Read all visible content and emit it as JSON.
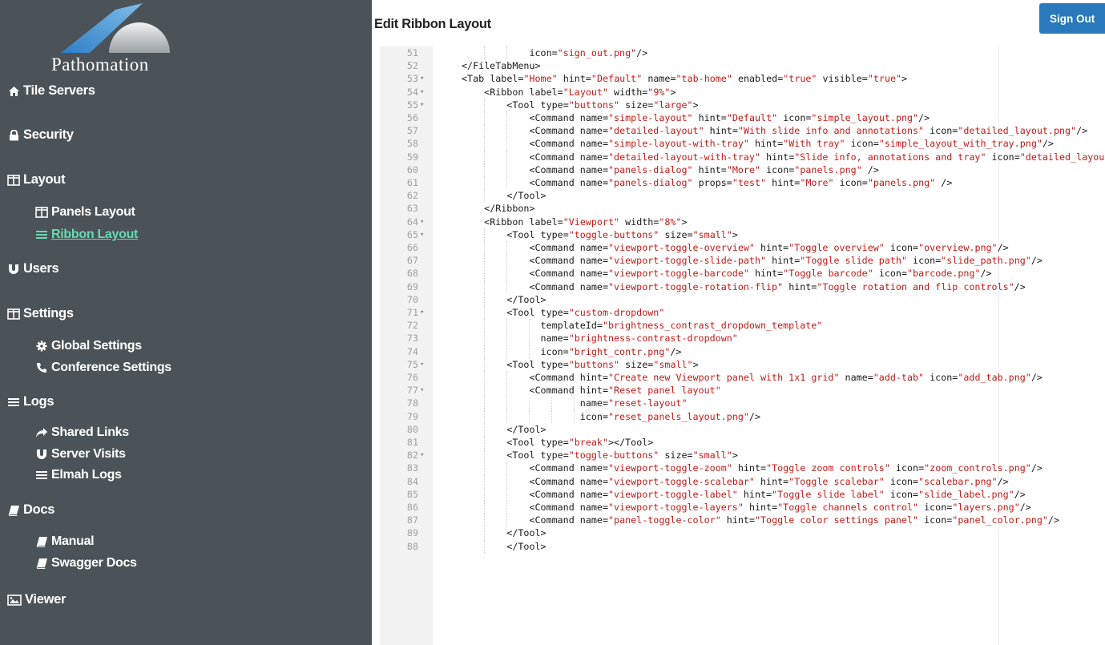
{
  "brand": {
    "logo_text": "Pathomation"
  },
  "colors": {
    "sidebar_bg": "#4b5358",
    "active_link": "#66d9b0",
    "primary_button": "#2a79bd",
    "code_string": "#c41a16"
  },
  "sidebar": {
    "items": [
      {
        "label": "Tile Servers",
        "icon": "home-icon"
      },
      {
        "label": "Security",
        "icon": "lock-icon"
      },
      {
        "label": "Layout",
        "icon": "columns-icon"
      },
      {
        "label": "Panels Layout",
        "icon": "columns-icon"
      },
      {
        "label": "Ribbon Layout",
        "icon": "list-icon",
        "active": true
      },
      {
        "label": "Users",
        "icon": "magnet-icon"
      },
      {
        "label": "Settings",
        "icon": "columns-icon"
      },
      {
        "label": "Global Settings",
        "icon": "cog-icon"
      },
      {
        "label": "Conference Settings",
        "icon": "phone-icon"
      },
      {
        "label": "Logs",
        "icon": "list-icon"
      },
      {
        "label": "Shared Links",
        "icon": "share-icon"
      },
      {
        "label": "Server Visits",
        "icon": "magnet-icon"
      },
      {
        "label": "Elmah Logs",
        "icon": "list-icon"
      },
      {
        "label": "Docs",
        "icon": "book-icon"
      },
      {
        "label": "Manual",
        "icon": "book-icon"
      },
      {
        "label": "Swagger Docs",
        "icon": "book-icon"
      },
      {
        "label": "Viewer",
        "icon": "picture-icon"
      }
    ]
  },
  "header": {
    "title": "Edit Ribbon Layout",
    "sign_out_label": "Sign Out"
  },
  "editor": {
    "lines": [
      {
        "n": "51",
        "fold": false,
        "code": "            icon=\"sign_out.png\"/>"
      },
      {
        "n": "52",
        "fold": false,
        "code": "</FileTabMenu>"
      },
      {
        "n": "53",
        "fold": true,
        "code": "<Tab label=\"Home\" hint=\"Default\" name=\"tab-home\" enabled=\"true\" visible=\"true\">"
      },
      {
        "n": "54",
        "fold": true,
        "code": "    <Ribbon label=\"Layout\" width=\"9%\">"
      },
      {
        "n": "55",
        "fold": true,
        "code": "        <Tool type=\"buttons\" size=\"large\">"
      },
      {
        "n": "56",
        "fold": false,
        "code": "            <Command name=\"simple-layout\" hint=\"Default\" icon=\"simple_layout.png\"/>"
      },
      {
        "n": "57",
        "fold": false,
        "code": "            <Command name=\"detailed-layout\" hint=\"With slide info and annotations\" icon=\"detailed_layout.png\"/>"
      },
      {
        "n": "58",
        "fold": false,
        "code": "            <Command name=\"simple-layout-with-tray\" hint=\"With tray\" icon=\"simple_layout_with_tray.png\"/>"
      },
      {
        "n": "59",
        "fold": false,
        "code": "            <Command name=\"detailed-layout-with-tray\" hint=\"Slide info, annotations and tray\" icon=\"detailed_layout_with_tray.png\"/>"
      },
      {
        "n": "60",
        "fold": false,
        "code": "            <Command name=\"panels-dialog\" hint=\"More\" icon=\"panels.png\" />"
      },
      {
        "n": "61",
        "fold": false,
        "code": "            <Command name=\"panels-dialog\" props=\"test\" hint=\"More\" icon=\"panels.png\" />"
      },
      {
        "n": "62",
        "fold": false,
        "code": "        </Tool>"
      },
      {
        "n": "63",
        "fold": false,
        "code": "    </Ribbon>"
      },
      {
        "n": "64",
        "fold": true,
        "code": "    <Ribbon label=\"Viewport\" width=\"8%\">"
      },
      {
        "n": "65",
        "fold": true,
        "code": "        <Tool type=\"toggle-buttons\" size=\"small\">"
      },
      {
        "n": "66",
        "fold": false,
        "code": "            <Command name=\"viewport-toggle-overview\" hint=\"Toggle overview\" icon=\"overview.png\"/>"
      },
      {
        "n": "67",
        "fold": false,
        "code": "            <Command name=\"viewport-toggle-slide-path\" hint=\"Toggle slide path\" icon=\"slide_path.png\"/>"
      },
      {
        "n": "68",
        "fold": false,
        "code": "            <Command name=\"viewport-toggle-barcode\" hint=\"Toggle barcode\" icon=\"barcode.png\"/>"
      },
      {
        "n": "69",
        "fold": false,
        "code": "            <Command name=\"viewport-toggle-rotation-flip\" hint=\"Toggle rotation and flip controls\"/>"
      },
      {
        "n": "70",
        "fold": false,
        "code": "        </Tool>"
      },
      {
        "n": "71",
        "fold": true,
        "code": "        <Tool type=\"custom-dropdown\""
      },
      {
        "n": "72",
        "fold": false,
        "code": "              templateId=\"brightness_contrast_dropdown_template\""
      },
      {
        "n": "73",
        "fold": false,
        "code": "              name=\"brightness-contrast-dropdown\""
      },
      {
        "n": "74",
        "fold": false,
        "code": "              icon=\"bright_contr.png\"/>"
      },
      {
        "n": "75",
        "fold": true,
        "code": "        <Tool type=\"buttons\" size=\"small\">"
      },
      {
        "n": "76",
        "fold": false,
        "code": "            <Command hint=\"Create new Viewport panel with 1x1 grid\" name=\"add-tab\" icon=\"add_tab.png\"/>"
      },
      {
        "n": "77",
        "fold": true,
        "code": "            <Command hint=\"Reset panel layout\""
      },
      {
        "n": "78",
        "fold": false,
        "code": "                     name=\"reset-layout\""
      },
      {
        "n": "79",
        "fold": false,
        "code": "                     icon=\"reset_panels_layout.png\"/>"
      },
      {
        "n": "80",
        "fold": false,
        "code": "        </Tool>"
      },
      {
        "n": "81",
        "fold": false,
        "code": "        <Tool type=\"break\"></Tool>"
      },
      {
        "n": "82",
        "fold": true,
        "code": "        <Tool type=\"toggle-buttons\" size=\"small\">"
      },
      {
        "n": "83",
        "fold": false,
        "code": "            <Command name=\"viewport-toggle-zoom\" hint=\"Toggle zoom controls\" icon=\"zoom_controls.png\"/>"
      },
      {
        "n": "84",
        "fold": false,
        "code": "            <Command name=\"viewport-toggle-scalebar\" hint=\"Toggle scalebar\" icon=\"scalebar.png\"/>"
      },
      {
        "n": "85",
        "fold": false,
        "code": "            <Command name=\"viewport-toggle-label\" hint=\"Toggle slide label\" icon=\"slide_label.png\"/>"
      },
      {
        "n": "86",
        "fold": false,
        "code": "            <Command name=\"viewport-toggle-layers\" hint=\"Toggle channels control\" icon=\"layers.png\"/>"
      },
      {
        "n": "87",
        "fold": false,
        "code": "            <Command name=\"panel-toggle-color\" hint=\"Toggle color settings panel\" icon=\"panel_color.png\"/>"
      },
      {
        "n": "89",
        "fold": false,
        "code": "        </Tool>"
      },
      {
        "n": "88",
        "fold": false,
        "code": "        </Tool>"
      }
    ]
  }
}
